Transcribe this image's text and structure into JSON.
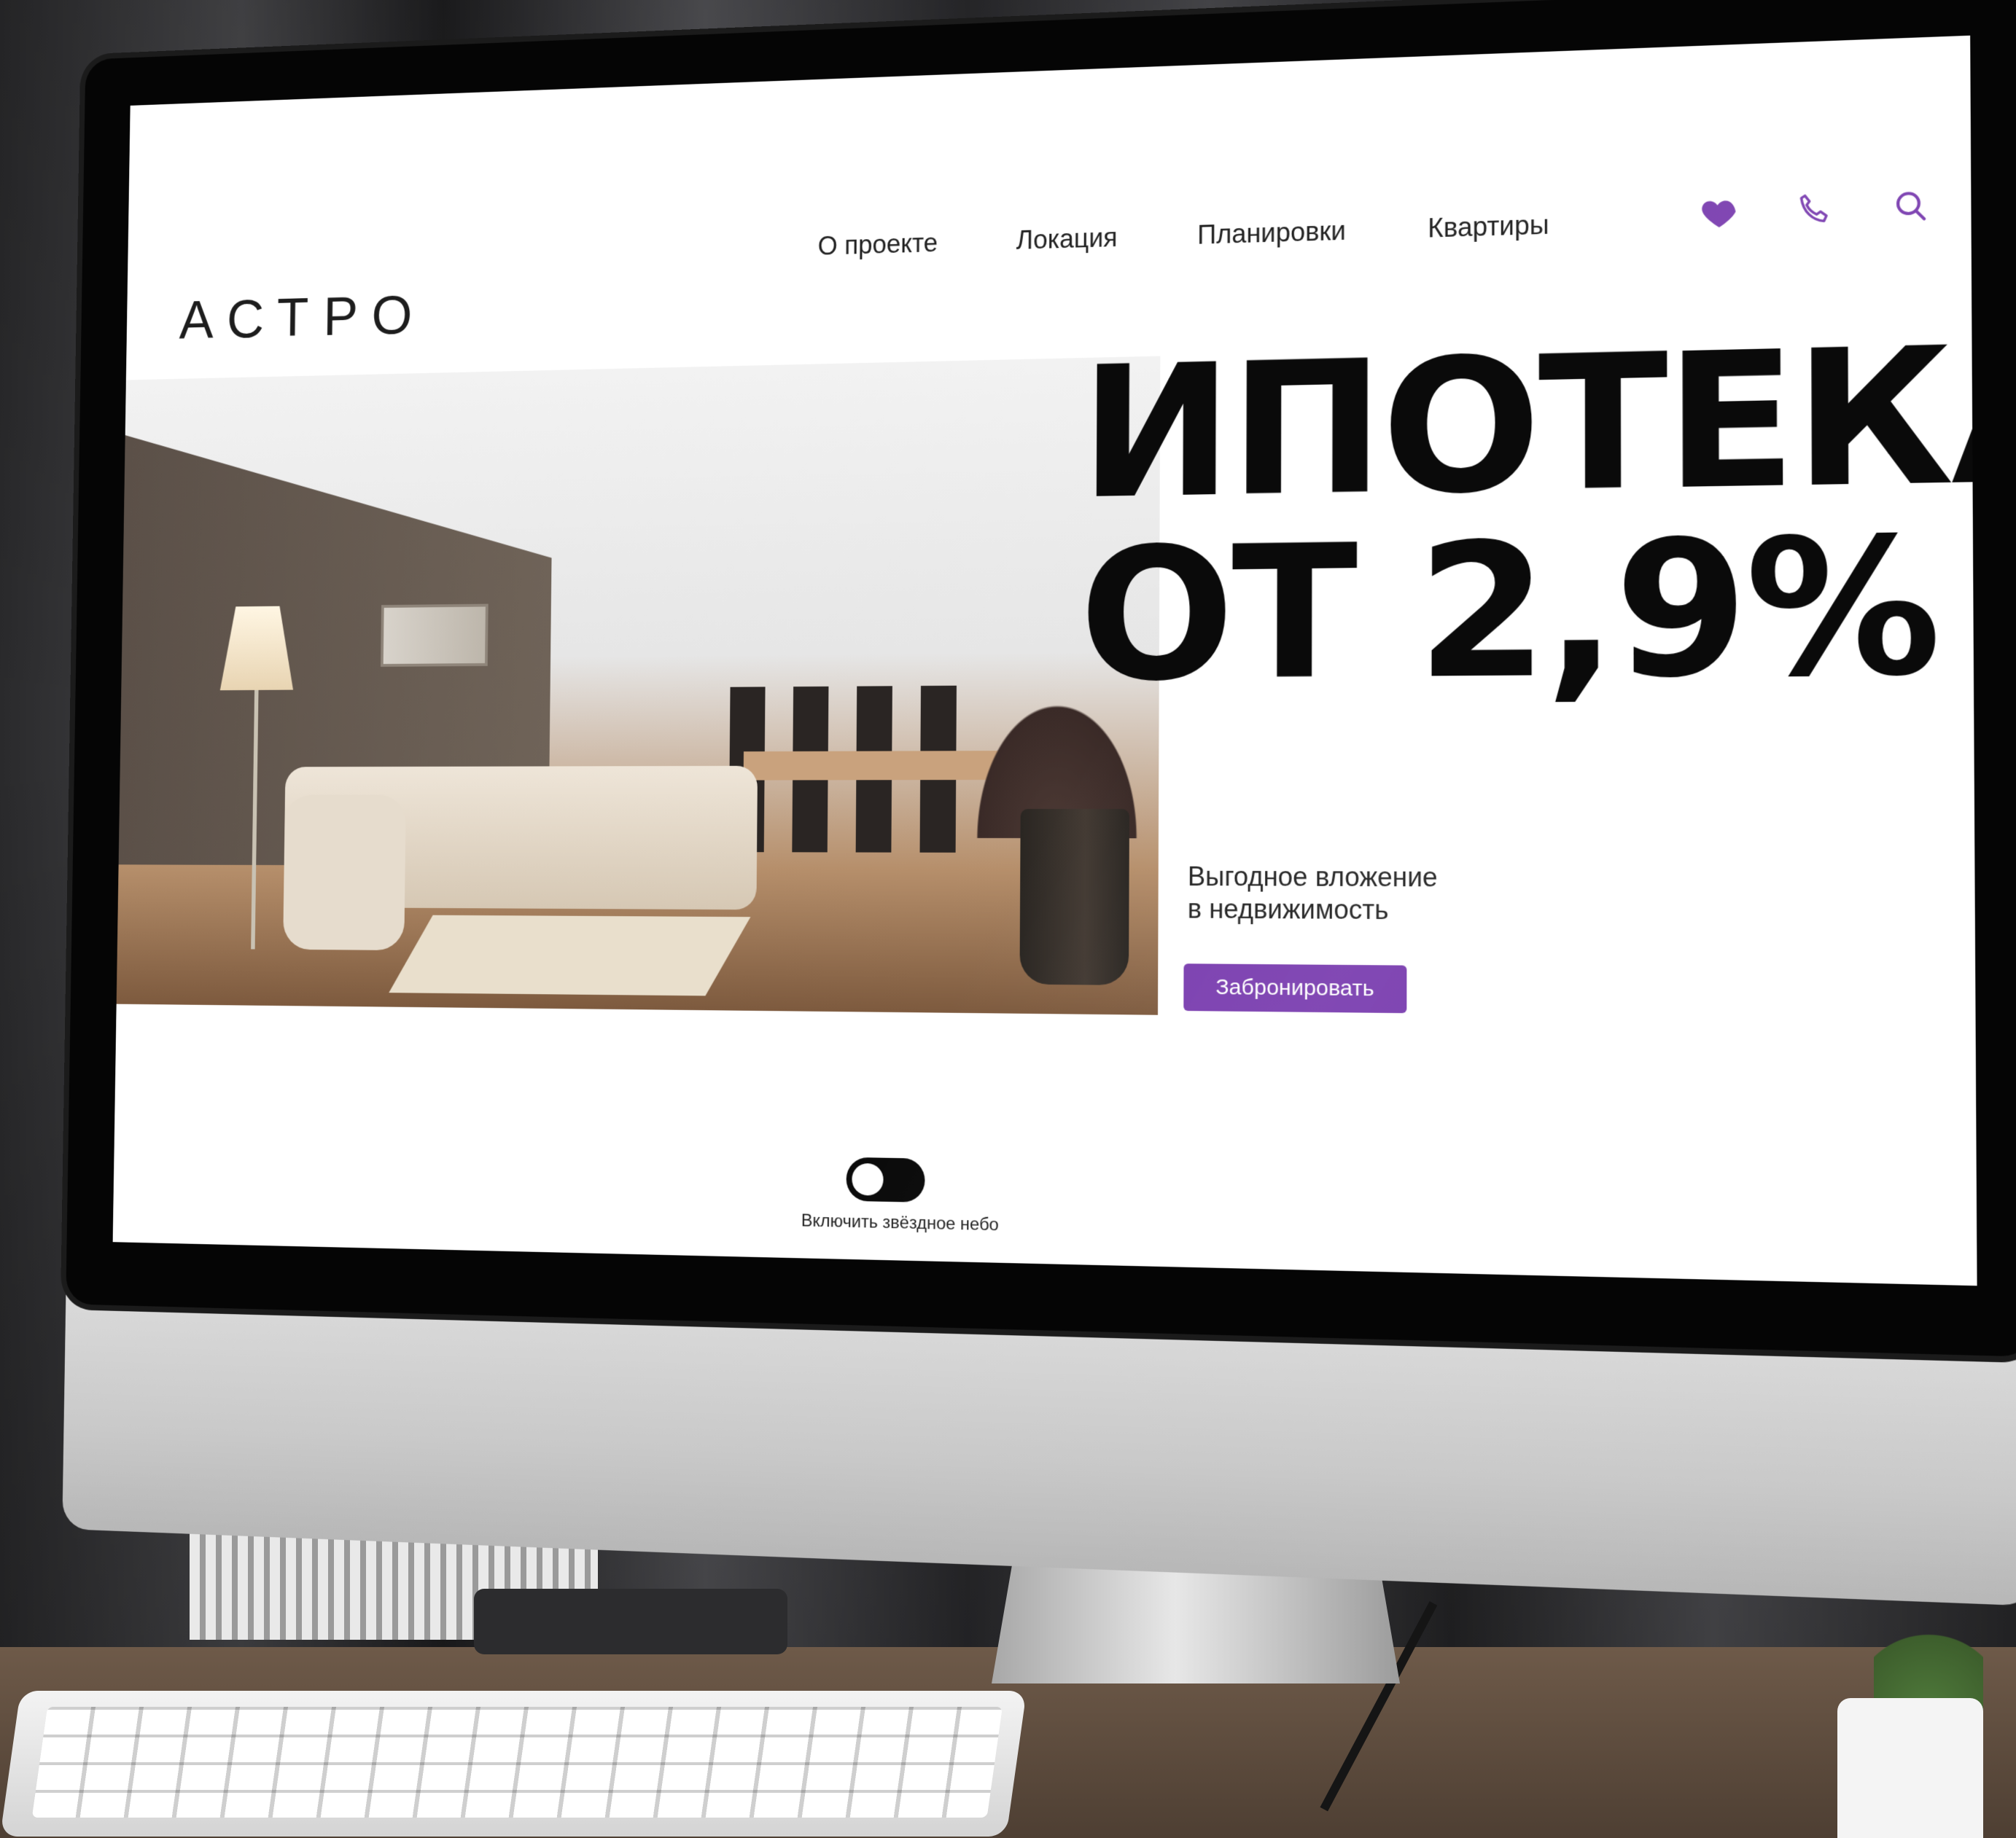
{
  "site": {
    "logo": "АСТРО",
    "nav": [
      {
        "label": "О проекте"
      },
      {
        "label": "Локация"
      },
      {
        "label": "Планировки"
      },
      {
        "label": "Квартиры"
      }
    ],
    "icons": {
      "favorite": "heart-icon",
      "phone": "phone-icon",
      "search": "search-icon"
    }
  },
  "hero": {
    "headline_line1": "ИПОТЕКА",
    "headline_line2": "ОТ 2,9%",
    "subtitle_line1": "Выгодное вложение",
    "subtitle_line2": "в недвижимость",
    "cta_label": "Забронировать"
  },
  "toggle": {
    "label": "Включить звёздное небо",
    "state": "off"
  },
  "colors": {
    "accent": "#7b3fb0",
    "text": "#0a0a0a",
    "background": "#ffffff"
  }
}
